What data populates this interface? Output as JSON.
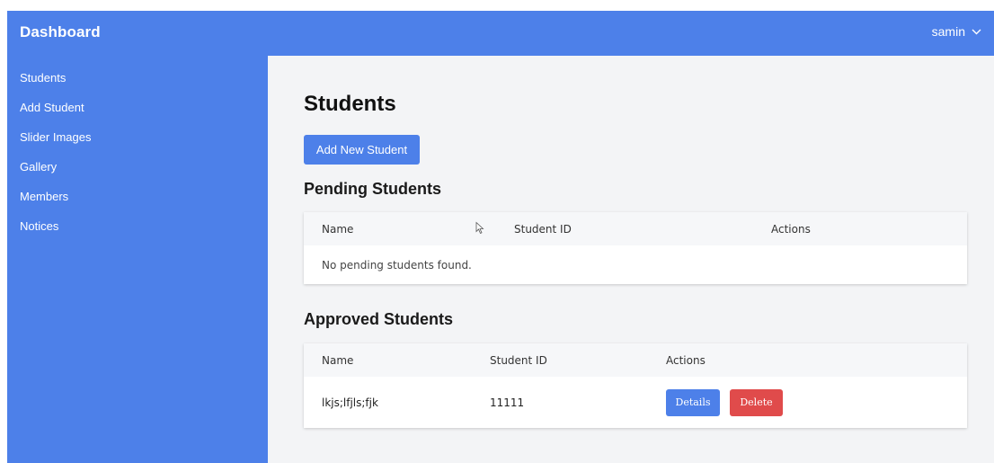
{
  "header": {
    "brand": "Dashboard",
    "user": "samin"
  },
  "sidebar": {
    "items": [
      {
        "label": "Students"
      },
      {
        "label": "Add Student"
      },
      {
        "label": "Slider Images"
      },
      {
        "label": "Gallery"
      },
      {
        "label": "Members"
      },
      {
        "label": "Notices"
      }
    ]
  },
  "main": {
    "title": "Students",
    "add_button": "Add New Student",
    "pending": {
      "title": "Pending Students",
      "columns": [
        "Name",
        "Student ID",
        "Actions"
      ],
      "empty_message": "No pending students found."
    },
    "approved": {
      "title": "Approved Students",
      "columns": [
        "Name",
        "Student ID",
        "Actions"
      ],
      "rows": [
        {
          "name": "lkjs;lfjls;fjk",
          "student_id": "11111",
          "details_label": "Details",
          "delete_label": "Delete"
        }
      ]
    }
  },
  "colors": {
    "primary": "#4d80e9",
    "danger": "#e04b4b",
    "background": "#f3f4f6"
  },
  "icons": {
    "user_menu": "chevron-down-icon",
    "pointer": "mouse-cursor-icon"
  }
}
